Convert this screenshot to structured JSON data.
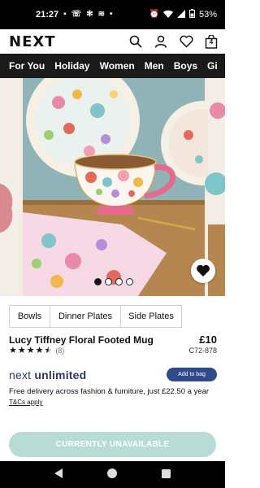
{
  "status_bar": {
    "time": "21:27",
    "battery": "53%"
  },
  "header": {
    "logo": "NEXT",
    "bag_count": "4"
  },
  "nav": {
    "items": [
      "For You",
      "Holiday",
      "Women",
      "Men",
      "Boys",
      "Gi"
    ]
  },
  "gallery": {
    "dot_count": 4,
    "active_dot": 1
  },
  "tabs": [
    {
      "label": "Bowls"
    },
    {
      "label": "Dinner Plates"
    },
    {
      "label": "Side Plates"
    }
  ],
  "product": {
    "title": "Lucy Tiffney Floral Footed Mug",
    "price": "£10",
    "rating": 4.5,
    "review_count": "(8)",
    "code": "C72-878"
  },
  "unlimited": {
    "logo_prefix": "next",
    "logo_suffix": "unlimited",
    "button_label": "Add to bag",
    "delivery_text": "Free delivery across fashion & furniture, just £22.50 a year",
    "tcs_label": "T&Cs apply"
  },
  "cta": {
    "label": "CURRENTLY UNAVAILABLE"
  },
  "colors": {
    "nav_bg": "#1a1a1a",
    "cta_bg": "#b7dcd6",
    "unlimited_blue": "#2f4a8a"
  }
}
